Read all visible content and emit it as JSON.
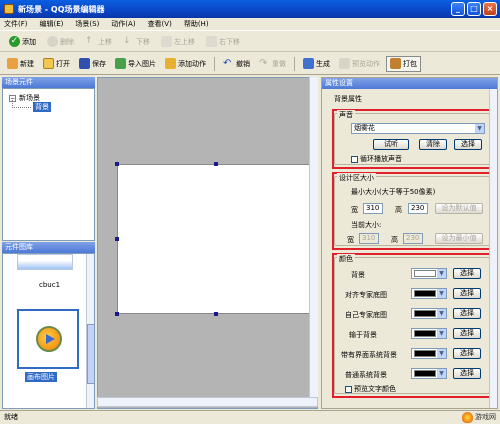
{
  "window": {
    "title": "新场景 - QQ场景编辑器"
  },
  "menu": [
    "文件(F)",
    "编辑(E)",
    "场景(S)",
    "动作(A)",
    "查看(V)",
    "帮助(H)"
  ],
  "toolbar1": [
    {
      "label": "添加",
      "icon": "add-icon",
      "enabled": true
    },
    {
      "label": "删除",
      "icon": "delete-icon",
      "enabled": false
    },
    {
      "label": "上移",
      "icon": "move-up-icon",
      "enabled": false
    },
    {
      "label": "下移",
      "icon": "move-down-icon",
      "enabled": false
    },
    {
      "label": "左上移",
      "icon": "move-left-icon",
      "enabled": false
    },
    {
      "label": "右下移",
      "icon": "move-right-icon",
      "enabled": false
    }
  ],
  "toolbar2": [
    {
      "label": "新建",
      "icon": "new-icon",
      "enabled": true
    },
    {
      "label": "打开",
      "icon": "open-folder-icon",
      "enabled": true
    },
    {
      "label": "保存",
      "icon": "save-icon",
      "enabled": true
    },
    {
      "label": "导入图片",
      "icon": "import-image-icon",
      "enabled": true
    },
    {
      "label": "添加动作",
      "icon": "add-action-icon",
      "enabled": true
    },
    {
      "label": "撤销",
      "icon": "undo-icon",
      "enabled": true
    },
    {
      "label": "重做",
      "icon": "redo-icon",
      "enabled": false
    },
    {
      "label": "生成",
      "icon": "generate-icon",
      "enabled": true
    },
    {
      "label": "预览动作",
      "icon": "preview-icon",
      "enabled": false
    },
    {
      "label": "打包",
      "icon": "package-icon",
      "enabled": true
    }
  ],
  "left": {
    "tree_title": "场景元件",
    "tree_root": "新场景",
    "tree_child": "背景",
    "library_title": "元件图库",
    "library_item1": "cbuc1",
    "library_item2": "画布图片"
  },
  "props": {
    "title": "属性设置",
    "bg_prop_label": "背景属性",
    "sound": {
      "group_label": "声音",
      "selected": "烟雾花",
      "btn_try": "试听",
      "btn_clear": "清除",
      "btn_select": "选择",
      "loop_label": "循环播放声音"
    },
    "size": {
      "group_label": "设计区大小",
      "min_label": "最小大小(大于等于50像素)",
      "width_label": "宽",
      "width_value": "310",
      "height_label": "高",
      "height_value": "230",
      "set_default_btn": "设为默认值",
      "current_label": "当前大小:",
      "cur_width_value": "310",
      "cur_height_value": "230",
      "set_min_btn": "设为最小值"
    },
    "colors": {
      "group_label": "颜色",
      "rows": [
        {
          "label": "背景",
          "color": "#ffffff",
          "btn": "选择"
        },
        {
          "label": "对齐专家底图",
          "color": "#000000",
          "btn": "选择"
        },
        {
          "label": "自己专家底图",
          "color": "#000000",
          "btn": "选择"
        },
        {
          "label": "输于背景",
          "color": "#000000",
          "btn": "选择"
        },
        {
          "label": "带有界面系统背景",
          "color": "#000000",
          "btn": "选择"
        },
        {
          "label": "普通系统背景",
          "color": "#000000",
          "btn": "选择"
        }
      ],
      "preview_label": "预览文字颜色"
    }
  },
  "status": {
    "text": "就绪"
  },
  "watermark": {
    "text": "游戏网"
  },
  "accent": {
    "highlight": "#e0202a",
    "selection": "#316ac5"
  }
}
